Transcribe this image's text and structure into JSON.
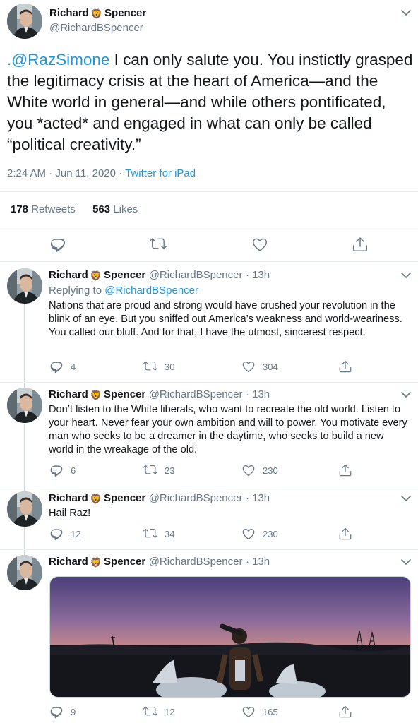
{
  "main_tweet": {
    "name_first": "Richard",
    "name_last": "Spencer",
    "name_emoji": "🦁",
    "handle": "@RichardBSpencer",
    "mention": ".@RazSimone",
    "text": " I can only salute you.  You instictly grasped the legitimacy crisis at the heart of America—and the White world in general—and while others pontificated, you *acted* and engaged in what can only be called “political creativity.”",
    "time": "2:24 AM · Jun 11, 2020",
    "separator": " · ",
    "source": "Twitter for iPad",
    "retweets_count": "178",
    "retweets_label": "Retweets",
    "likes_count": "563",
    "likes_label": "Likes"
  },
  "replies": [
    {
      "name_first": "Richard",
      "name_last": "Spencer",
      "handle": "@RichardBSpencer",
      "time": "· 13h",
      "replying_label": "Replying to",
      "replying_to": "@RichardBSpencer",
      "text": "Nations that are proud and strong would have crushed your revolution in the blink of an eye. But you sniffed out America’s weakness and world-weariness. You called our bluff. And for that, I have the utmost, sincerest respect.",
      "replies": "4",
      "retweets": "30",
      "likes": "304"
    },
    {
      "name_first": "Richard",
      "name_last": "Spencer",
      "handle": "@RichardBSpencer",
      "time": "· 13h",
      "text": "Don’t listen to the White liberals, who want to recreate the old world. Listen to your heart. Never fear your own ambition and will to power.  You motivate every man who seeks to be a dreamer in the daytime, who seeks to build a new world in the wreakage of the old.",
      "replies": "6",
      "retweets": "23",
      "likes": "230"
    },
    {
      "name_first": "Richard",
      "name_last": "Spencer",
      "handle": "@RichardBSpencer",
      "time": "· 13h",
      "text": "Hail Raz!",
      "replies": "12",
      "retweets": "34",
      "likes": "230"
    },
    {
      "name_first": "Richard",
      "name_last": "Spencer",
      "handle": "@RichardBSpencer",
      "time": "· 13h",
      "replies": "9",
      "retweets": "12",
      "likes": "165"
    }
  ],
  "icons": {
    "emoji": "lion-face-icon",
    "reply": "reply-icon",
    "retweet": "retweet-icon",
    "like": "heart-icon",
    "share": "share-icon",
    "more": "chevron-down-icon"
  },
  "colors": {
    "link": "#1b95e0",
    "muted": "#657786",
    "divider": "#e6ecf0"
  }
}
